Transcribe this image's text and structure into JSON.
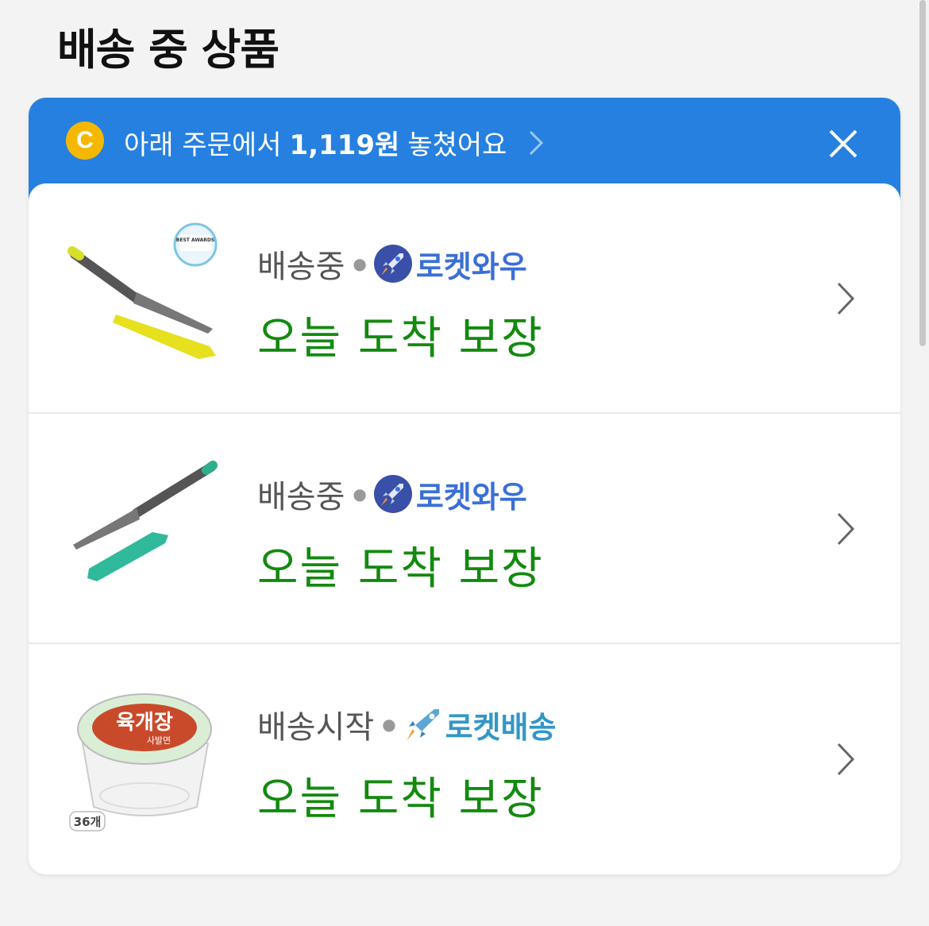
{
  "page_title": "배송 중 상품",
  "banner": {
    "coin_letter": "C",
    "text_before": "아래 주문에서",
    "amount": "1,119원",
    "text_after": "놓쳤어요"
  },
  "orders": [
    {
      "status": "배송중",
      "badge_label": "로켓와우",
      "arrival": "오늘 도착 보장",
      "product_icon": "knife-yellow-sheath",
      "award_badge": "BEST AWARDS"
    },
    {
      "status": "배송중",
      "badge_label": "로켓와우",
      "arrival": "오늘 도착 보장",
      "product_icon": "knife-teal-sheath"
    },
    {
      "status": "배송시작",
      "badge_label": "로켓배송",
      "arrival": "오늘 도착 보장",
      "product_icon": "noodle-cup",
      "product_label": "육개장",
      "product_sub": "사발면",
      "quantity_tag": "36개"
    }
  ],
  "colors": {
    "banner_bg": "#2580e0",
    "arrival_green": "#138a0e",
    "wow_blue": "#3a6fd8",
    "rocket_blue": "#3396c8"
  }
}
